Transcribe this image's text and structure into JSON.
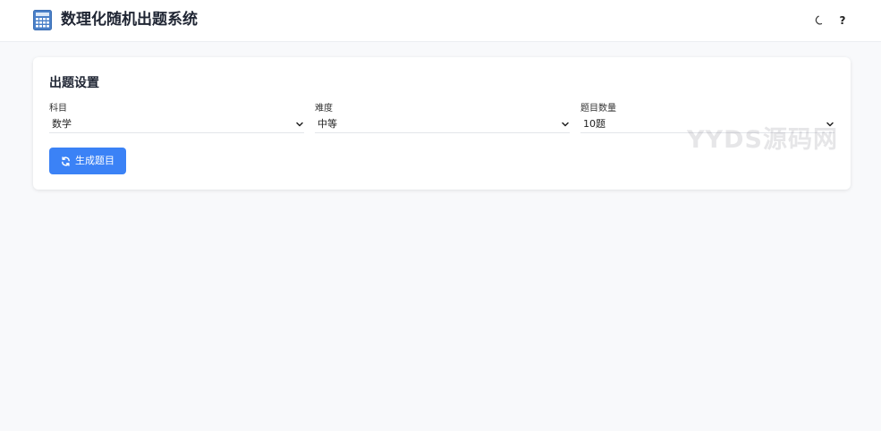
{
  "header": {
    "app_title": "数理化随机出题系统",
    "logo_icon": "calculator-icon",
    "theme_toggle_icon": "moon-icon",
    "help_symbol": "?"
  },
  "settings": {
    "title": "出题设置",
    "fields": [
      {
        "label": "科目",
        "value": "数学"
      },
      {
        "label": "难度",
        "value": "中等"
      },
      {
        "label": "题目数量",
        "value": "10题"
      }
    ],
    "generate_label": "生成题目",
    "generate_icon": "refresh-icon"
  },
  "watermark": "YYDS源码网",
  "colors": {
    "accent": "#3b82f6",
    "background": "#f8f9fb",
    "card": "#ffffff"
  }
}
